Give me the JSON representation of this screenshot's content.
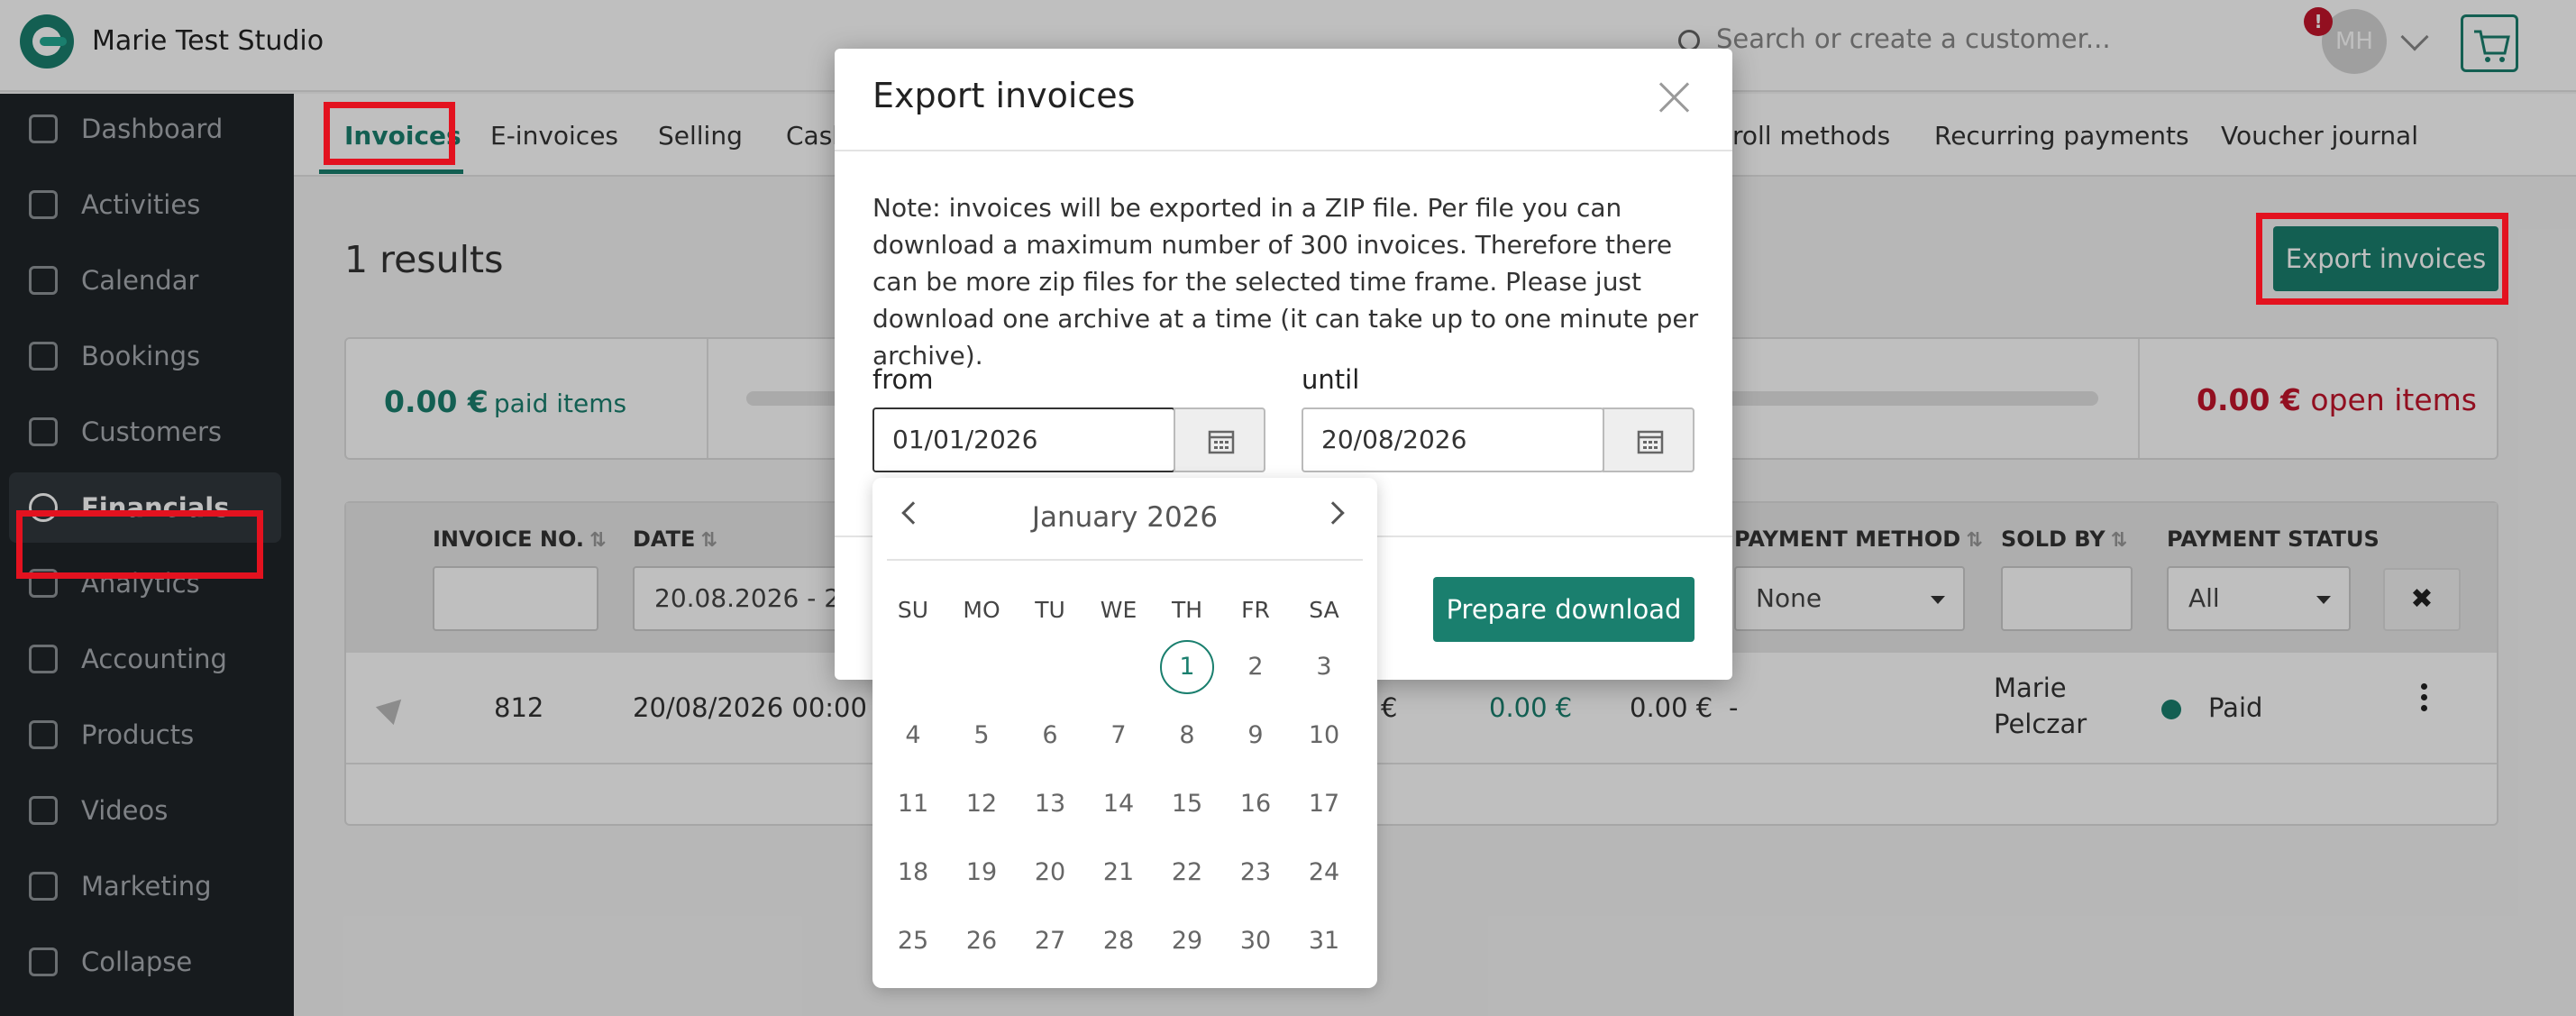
{
  "app": {
    "studio_name": "Marie Test Studio"
  },
  "header": {
    "search_placeholder": "Search or create a customer...",
    "avatar_initials": "MH",
    "alert_badge": "!"
  },
  "sidebar": {
    "items": [
      {
        "label": "Dashboard",
        "icon": "home-icon"
      },
      {
        "label": "Activities",
        "icon": "bolt-icon"
      },
      {
        "label": "Calendar",
        "icon": "calendar-icon"
      },
      {
        "label": "Bookings",
        "icon": "list-icon"
      },
      {
        "label": "Customers",
        "icon": "user-icon"
      },
      {
        "label": "Financials",
        "icon": "euro-icon"
      },
      {
        "label": "Analytics",
        "icon": "chart-icon"
      },
      {
        "label": "Accounting",
        "icon": "clipboard-icon"
      },
      {
        "label": "Products",
        "icon": "box-icon"
      },
      {
        "label": "Videos",
        "icon": "play-icon"
      },
      {
        "label": "Marketing",
        "icon": "megaphone-icon"
      },
      {
        "label": "Collapse",
        "icon": "collapse-icon"
      }
    ]
  },
  "tabs": [
    "Invoices",
    "E-invoices",
    "Selling",
    "Cash",
    "roll methods",
    "Recurring payments",
    "Voucher journal"
  ],
  "main": {
    "results": "1 results",
    "export_button": "Export invoices",
    "summary": {
      "paid_amount": "0.00 €",
      "paid_label": "paid items",
      "open_amount": "0.00 €",
      "open_label": "open items"
    }
  },
  "table": {
    "headers": {
      "invoice_no": "INVOICE NO.",
      "date": "DATE",
      "payment_method": "PAYMENT METHOD",
      "sold_by": "SOLD BY",
      "payment_status": "PAYMENT STATUS"
    },
    "filters": {
      "date": "20.08.2026 - 2",
      "payment_method": "None",
      "payment_status": "All"
    },
    "row": {
      "invoice_no": "812",
      "date": "20/08/2026 00:00",
      "amount_a": "€",
      "amount_paid": "0.00 €",
      "amount_open": "0.00 €",
      "payment_method": "-",
      "sold_by_first": "Marie",
      "sold_by_last": "Pelczar",
      "status": "Paid"
    }
  },
  "modal": {
    "title": "Export invoices",
    "note": "Note: invoices will be exported in a ZIP file. Per file you can download a maximum number of 300 invoices. Therefore there can be more zip files for the selected time frame. Please just download one archive at a time (it can take up to one minute per archive).",
    "from_label": "from",
    "from_value": "01/01/2026",
    "until_label": "until",
    "until_value": "20/08/2026",
    "prepare_button": "Prepare download"
  },
  "calendar": {
    "month": "January 2026",
    "weekdays": [
      "SU",
      "MO",
      "TU",
      "WE",
      "TH",
      "FR",
      "SA"
    ],
    "selected_day": 1,
    "first_weekday_index": 4,
    "days_in_month": 31
  },
  "colors": {
    "accent": "#1a7f6e",
    "danger": "#c3142b",
    "highlight": "#e3121f"
  }
}
